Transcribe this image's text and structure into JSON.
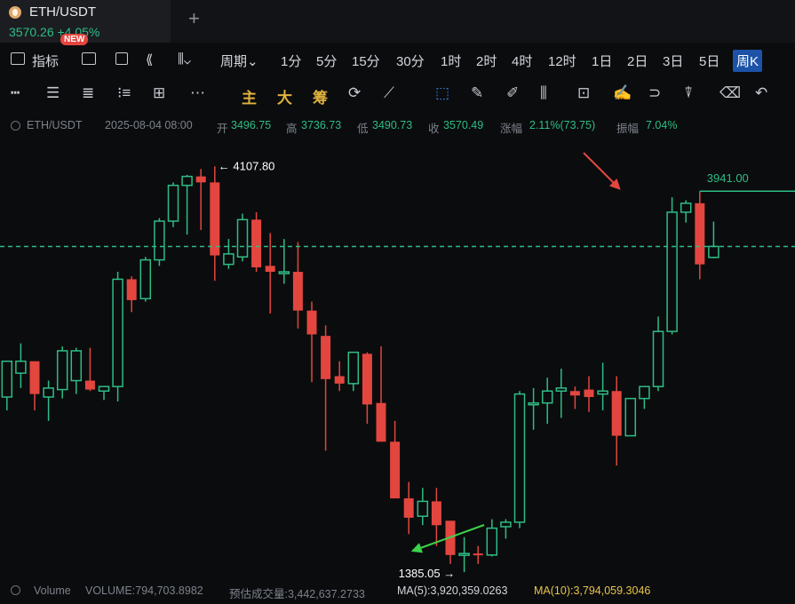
{
  "tab": {
    "title": "ETH/USDT",
    "price_line": "3570.26 +4.05%",
    "new_badge": "NEW"
  },
  "period_bar": {
    "indicator": "指标",
    "period": "周期",
    "intervals": [
      "1分",
      "5分",
      "15分",
      "30分",
      "1时",
      "2时",
      "4时",
      "12时",
      "1日",
      "2日",
      "3日",
      "5日",
      "周K"
    ],
    "active": "周K"
  },
  "draw_bar": {
    "main": "主",
    "big": "大",
    "chip": "筹"
  },
  "info": {
    "symbol": "ETH/USDT",
    "datetime": "2025-08-04 08:00",
    "open_label": "开",
    "open": "3496.75",
    "high_label": "高",
    "high": "3736.73",
    "low_label": "低",
    "low": "3490.73",
    "close_label": "收",
    "close": "3570.49",
    "change_label": "涨幅",
    "change": "2.11%(73.75)",
    "amp_label": "振幅",
    "amp": "7.04%"
  },
  "volume": {
    "label": "Volume",
    "value": "VOLUME:794,703.8982",
    "estimate": "预估成交量:3,442,637.2733",
    "ma5": "MA(5):3,920,359.0263",
    "ma10": "MA(10):3,794,059.3046"
  },
  "colors": {
    "up": "#2ebd85",
    "down": "#e3463f",
    "background": "#0b0c0e",
    "accent": "#1c53a8"
  },
  "chart_data": {
    "type": "candlestick",
    "y_range": [
      1350,
      4300
    ],
    "current_price": 3570.26,
    "annotations": {
      "high_label": "4107.80",
      "low_label": "1385.05",
      "level_label": "3941.00",
      "high": 4107.8,
      "low": 1385.05,
      "level": 3941.0
    },
    "candles": [
      {
        "o": 2560,
        "h": 2800,
        "l": 2470,
        "c": 2800
      },
      {
        "o": 2720,
        "h": 2920,
        "l": 2620,
        "c": 2800
      },
      {
        "o": 2800,
        "h": 2790,
        "l": 2470,
        "c": 2580
      },
      {
        "o": 2560,
        "h": 2670,
        "l": 2400,
        "c": 2620
      },
      {
        "o": 2610,
        "h": 2900,
        "l": 2550,
        "c": 2870
      },
      {
        "o": 2670,
        "h": 2890,
        "l": 2580,
        "c": 2870
      },
      {
        "o": 2670,
        "h": 2890,
        "l": 2600,
        "c": 2610
      },
      {
        "o": 2600,
        "h": 2630,
        "l": 2540,
        "c": 2630
      },
      {
        "o": 2630,
        "h": 3400,
        "l": 2530,
        "c": 3350
      },
      {
        "o": 3350,
        "h": 3370,
        "l": 3130,
        "c": 3210
      },
      {
        "o": 3220,
        "h": 3500,
        "l": 3200,
        "c": 3480
      },
      {
        "o": 3480,
        "h": 3760,
        "l": 3440,
        "c": 3740
      },
      {
        "o": 3740,
        "h": 4000,
        "l": 3700,
        "c": 3980
      },
      {
        "o": 3980,
        "h": 4050,
        "l": 3650,
        "c": 4040
      },
      {
        "o": 4040,
        "h": 4090,
        "l": 3680,
        "c": 4000
      },
      {
        "o": 4000,
        "h": 4107.8,
        "l": 3340,
        "c": 3510
      },
      {
        "o": 3450,
        "h": 3620,
        "l": 3420,
        "c": 3520
      },
      {
        "o": 3500,
        "h": 3790,
        "l": 3470,
        "c": 3750
      },
      {
        "o": 3750,
        "h": 3800,
        "l": 3400,
        "c": 3430
      },
      {
        "o": 3440,
        "h": 3660,
        "l": 3120,
        "c": 3400
      },
      {
        "o": 3400,
        "h": 3620,
        "l": 3320,
        "c": 3400
      },
      {
        "o": 3400,
        "h": 3600,
        "l": 3020,
        "c": 3140
      },
      {
        "o": 3140,
        "h": 3200,
        "l": 2660,
        "c": 2980
      },
      {
        "o": 2970,
        "h": 3040,
        "l": 2200,
        "c": 2680
      },
      {
        "o": 2700,
        "h": 2800,
        "l": 2600,
        "c": 2650
      },
      {
        "o": 2650,
        "h": 2860,
        "l": 2600,
        "c": 2860
      },
      {
        "o": 2850,
        "h": 2860,
        "l": 2380,
        "c": 2510
      },
      {
        "o": 2520,
        "h": 2900,
        "l": 2280,
        "c": 2260
      },
      {
        "o": 2260,
        "h": 2400,
        "l": 2000,
        "c": 1880
      },
      {
        "o": 1880,
        "h": 1990,
        "l": 1640,
        "c": 1750
      },
      {
        "o": 1760,
        "h": 1950,
        "l": 1700,
        "c": 1860
      },
      {
        "o": 1860,
        "h": 1950,
        "l": 1560,
        "c": 1700
      },
      {
        "o": 1730,
        "h": 1660,
        "l": 1440,
        "c": 1500
      },
      {
        "o": 1500,
        "h": 1620,
        "l": 1385.05,
        "c": 1510
      },
      {
        "o": 1510,
        "h": 1560,
        "l": 1440,
        "c": 1500
      },
      {
        "o": 1500,
        "h": 1740,
        "l": 1490,
        "c": 1680
      },
      {
        "o": 1690,
        "h": 1740,
        "l": 1610,
        "c": 1720
      },
      {
        "o": 1720,
        "h": 2600,
        "l": 1680,
        "c": 2580
      },
      {
        "o": 2520,
        "h": 2620,
        "l": 2340,
        "c": 2520
      },
      {
        "o": 2520,
        "h": 2690,
        "l": 2380,
        "c": 2600
      },
      {
        "o": 2600,
        "h": 2750,
        "l": 2420,
        "c": 2620
      },
      {
        "o": 2600,
        "h": 2630,
        "l": 2480,
        "c": 2570
      },
      {
        "o": 2610,
        "h": 2700,
        "l": 2460,
        "c": 2560
      },
      {
        "o": 2580,
        "h": 2790,
        "l": 2470,
        "c": 2600
      },
      {
        "o": 2600,
        "h": 2700,
        "l": 2100,
        "c": 2300
      },
      {
        "o": 2300,
        "h": 2550,
        "l": 2300,
        "c": 2550
      },
      {
        "o": 2550,
        "h": 2620,
        "l": 2480,
        "c": 2630
      },
      {
        "o": 2630,
        "h": 3100,
        "l": 2600,
        "c": 3000
      },
      {
        "o": 3000,
        "h": 3900,
        "l": 2980,
        "c": 3800
      },
      {
        "o": 3800,
        "h": 3880,
        "l": 3730,
        "c": 3860
      },
      {
        "o": 3860,
        "h": 3941.0,
        "l": 3350,
        "c": 3450
      },
      {
        "o": 3496.75,
        "h": 3736.73,
        "l": 3490.73,
        "c": 3570.49
      }
    ]
  }
}
